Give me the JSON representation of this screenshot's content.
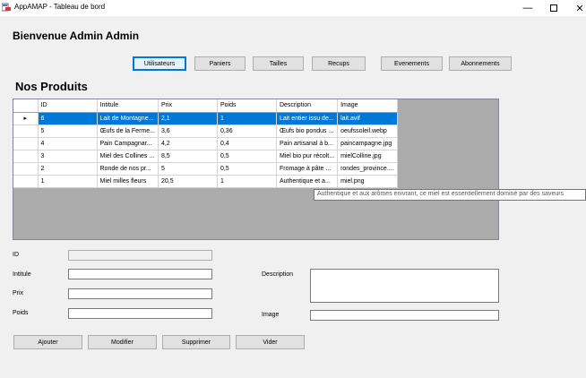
{
  "window": {
    "title": "AppAMAP - Tableau de bord"
  },
  "header": {
    "welcome": "Bienvenue Admin Admin"
  },
  "nav": {
    "items": [
      {
        "label": "Utilisateurs",
        "active": true
      },
      {
        "label": "Paniers",
        "active": false
      },
      {
        "label": "Tailles",
        "active": false
      },
      {
        "label": "Recups",
        "active": false
      },
      {
        "label": "Evenements",
        "active": false
      },
      {
        "label": "Abonnements",
        "active": false
      }
    ]
  },
  "products": {
    "title": "Nos Produits",
    "columns": [
      "ID",
      "Intitule",
      "Prix",
      "Poids",
      "Description",
      "Image"
    ],
    "rows": [
      {
        "id": "6",
        "intitule": "Lait de Montagne...",
        "prix": "2,1",
        "poids": "1",
        "description": "Lait entier issu de...",
        "image": "lait.avif",
        "selected": true
      },
      {
        "id": "5",
        "intitule": "Œufs de la Ferme...",
        "prix": "3,6",
        "poids": "0,36",
        "description": "Œufs bio pondus ...",
        "image": "oeufssoleil.webp",
        "selected": false
      },
      {
        "id": "4",
        "intitule": "Pain Campagnar...",
        "prix": "4,2",
        "poids": "0,4",
        "description": "Pain artisanal à b...",
        "image": "paincampagne.jpg",
        "selected": false
      },
      {
        "id": "3",
        "intitule": "Miel des Collines ...",
        "prix": "8,5",
        "poids": "0,5",
        "description": "Miel bio pur récolt...",
        "image": "mielColline.jpg",
        "selected": false
      },
      {
        "id": "2",
        "intitule": "Ronde de nos pr...",
        "prix": "5",
        "poids": "0,5",
        "description": "Fromage à pâte ...",
        "image": "rondes_province....",
        "selected": false
      },
      {
        "id": "1",
        "intitule": "Miel milles fleurs",
        "prix": "20,5",
        "poids": "1",
        "description": "Authentique et a...",
        "image": "miel.png",
        "selected": false
      }
    ],
    "tooltip": "Authentique et aux arômes enivrant, ce miel est essentiellement dominé par des saveurs"
  },
  "form": {
    "id_label": "ID",
    "intitule_label": "Intitule",
    "prix_label": "Prix",
    "poids_label": "Poids",
    "description_label": "Description",
    "image_label": "Image",
    "id_value": "",
    "intitule_value": "",
    "prix_value": "",
    "poids_value": "",
    "description_value": "",
    "image_value": ""
  },
  "actions": {
    "ajouter": "Ajouter",
    "modifier": "Modifier",
    "supprimer": "Supprimer",
    "vider": "Vider"
  }
}
